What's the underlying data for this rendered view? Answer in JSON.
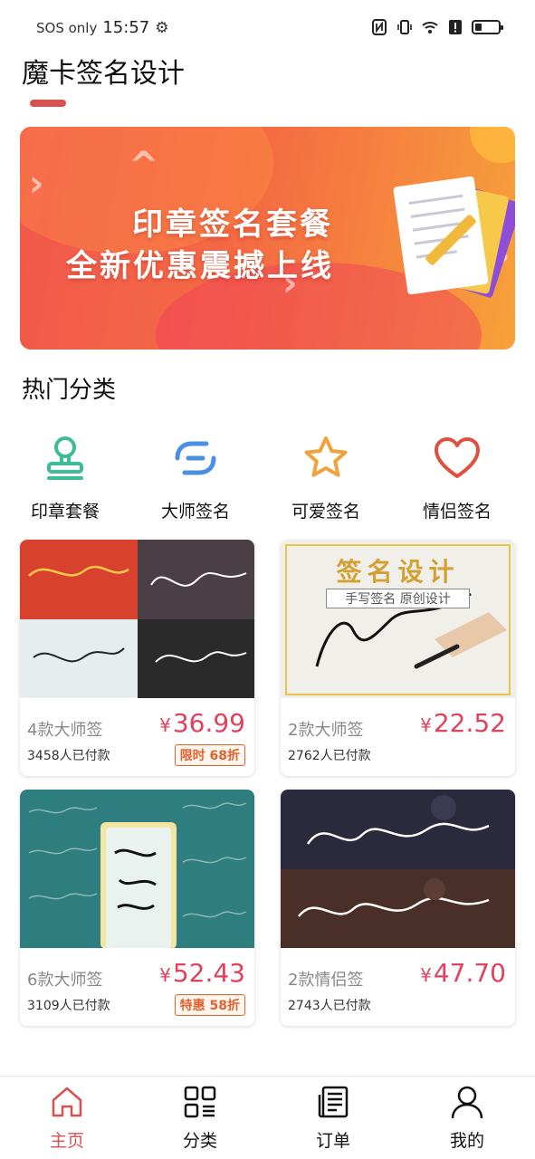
{
  "status_bar": {
    "carrier": "SOS only",
    "time": "15:57",
    "battery_level": 0.3
  },
  "page": {
    "title": "魔卡签名设计"
  },
  "banner": {
    "line1": "印章签名套餐",
    "line2": "全新优惠震撼上线"
  },
  "section": {
    "hot_categories": "热门分类"
  },
  "categories": [
    {
      "label": "印章套餐",
      "icon": "stamp-icon",
      "color": "#3dbd95"
    },
    {
      "label": "大师签名",
      "icon": "signature-link-icon",
      "color": "#4c8fe0"
    },
    {
      "label": "可爱签名",
      "icon": "star-icon",
      "color": "#f0a23c"
    },
    {
      "label": "情侣签名",
      "icon": "heart-icon",
      "color": "#e0503e"
    }
  ],
  "products": [
    {
      "name": "4款大师签",
      "price": "36.99",
      "currency": "¥",
      "paid": "3458人已付款",
      "tag": "限时 68折"
    },
    {
      "name": "2款大师签",
      "price": "22.52",
      "currency": "¥",
      "paid": "2762人已付款",
      "tag": "",
      "image_title": "签名设计",
      "image_subtitle": "手写签名 原创设计"
    },
    {
      "name": "6款大师签",
      "price": "52.43",
      "currency": "¥",
      "paid": "3109人已付款",
      "tag": "特惠 58折"
    },
    {
      "name": "2款情侣签",
      "price": "47.70",
      "currency": "¥",
      "paid": "2743人已付款",
      "tag": ""
    }
  ],
  "bottom_nav": [
    {
      "label": "主页",
      "icon": "home-icon",
      "active": true
    },
    {
      "label": "分类",
      "icon": "grid-list-icon",
      "active": false
    },
    {
      "label": "订单",
      "icon": "document-icon",
      "active": false
    },
    {
      "label": "我的",
      "icon": "person-icon",
      "active": false
    }
  ],
  "colors": {
    "accent": "#d9514e",
    "price": "#e0415c",
    "tag": "#e4612e"
  }
}
